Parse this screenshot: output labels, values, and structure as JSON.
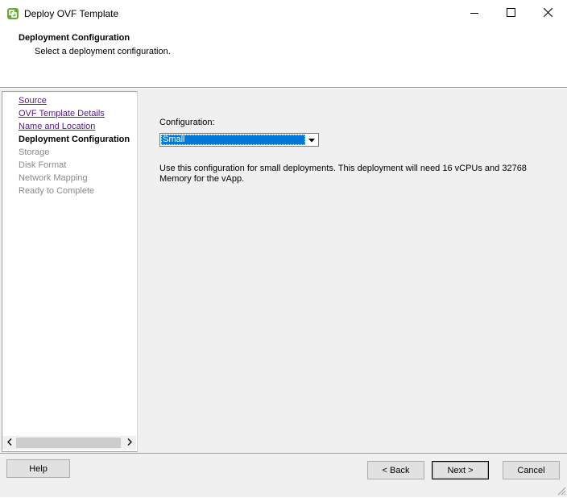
{
  "window": {
    "title": "Deploy OVF Template",
    "icon": "vsphere-icon",
    "controls": [
      "minimize-icon",
      "maximize-icon",
      "close-icon"
    ]
  },
  "header": {
    "title": "Deployment Configuration",
    "subtitle": "Select a deployment configuration."
  },
  "nav": {
    "items": [
      {
        "label": "Source",
        "state": "visited"
      },
      {
        "label": "OVF Template Details",
        "state": "visited"
      },
      {
        "label": "Name and Location",
        "state": "visited"
      },
      {
        "label": "Deployment Configuration",
        "state": "current"
      },
      {
        "label": "Storage",
        "state": "future"
      },
      {
        "label": "Disk Format",
        "state": "future"
      },
      {
        "label": "Network Mapping",
        "state": "future"
      },
      {
        "label": "Ready to Complete",
        "state": "future"
      }
    ]
  },
  "main": {
    "config_label": "Configuration:",
    "config_value": "Small",
    "description": "Use this configuration for small deployments. This deployment will need 16 vCPUs and 32768 Memory for the vApp."
  },
  "footer": {
    "help": "Help",
    "back": "< Back",
    "next": "Next >",
    "cancel": "Cancel"
  },
  "colors": {
    "selection": "#0078d7",
    "visited_link": "#551a8b",
    "disabled_text": "#8a8a8a",
    "dialog_bg": "#f0f0f0"
  }
}
